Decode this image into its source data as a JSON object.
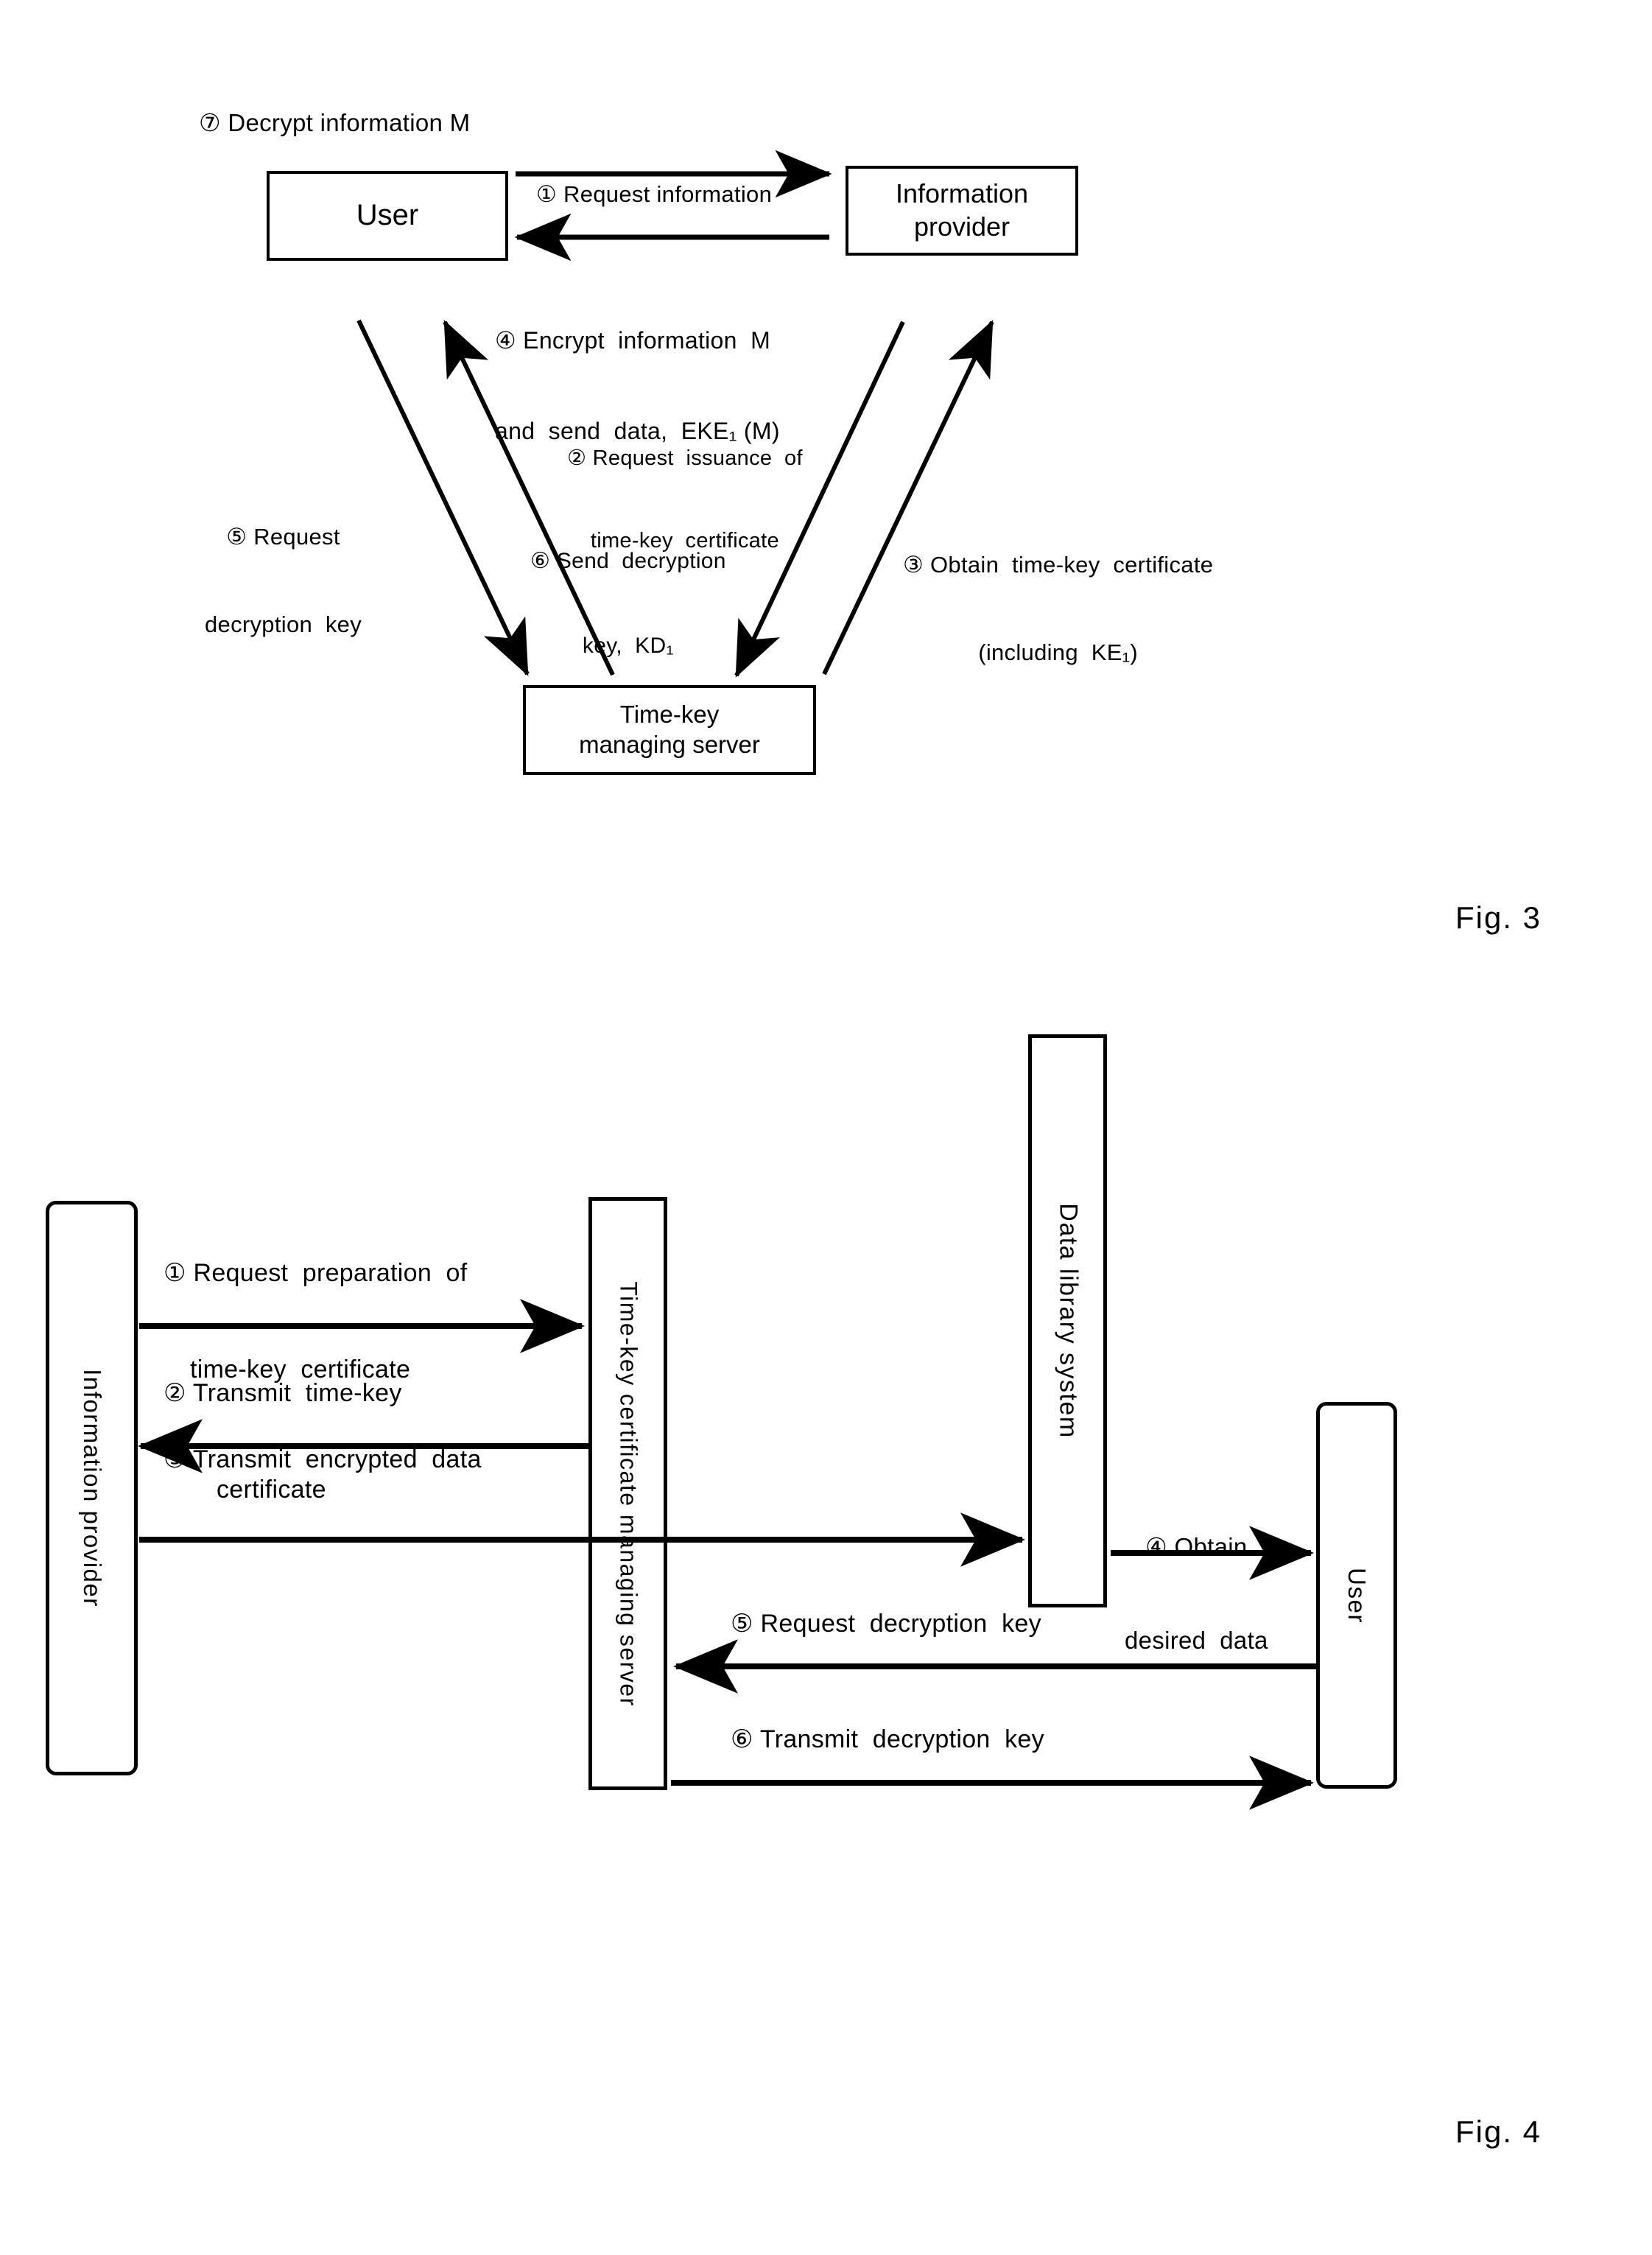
{
  "document": {
    "kind": "patent-figure-sheet",
    "figures": [
      {
        "caption": "Fig. 3"
      },
      {
        "caption": "Fig. 4"
      }
    ]
  },
  "fig3": {
    "caption": "Fig. 3",
    "nodes": {
      "user": "User",
      "provider_line1": "Information",
      "provider_line2": "provider",
      "server_line1": "Time-key",
      "server_line2": "managing server"
    },
    "labels": {
      "step7": "⑦ Decrypt information M",
      "step1": "① Request information",
      "step4_line1": "④ Encrypt  information  M",
      "step4_line2": "and  send  data,  EKE₁ (M)",
      "step2_line1": "② Request  issuance  of",
      "step2_line2": "time-key  certificate",
      "step5_line1": "⑤ Request",
      "step5_line2": "decryption  key",
      "step6_line1": "⑥ Send  decryption",
      "step6_line2": "key,  KD₁",
      "step3_line1": "③ Obtain  time-key  certificate",
      "step3_line2": "(including  KE₁)"
    }
  },
  "fig4": {
    "caption": "Fig. 4",
    "lifelines": {
      "information_provider": "Information provider",
      "timekey_server": "Time-key certificate managing server",
      "data_library": "Data library system",
      "user": "User"
    },
    "messages": {
      "step1_line1": "① Request  preparation  of",
      "step1_line2": "time-key  certificate",
      "step2_line1": "② Transmit  time-key",
      "step2_line2": "certificate",
      "step3": "③ Transmit  encrypted  data",
      "step4_line1": "④ Obtain",
      "step4_line2": "desired  data",
      "step5": "⑤ Request  decryption  key",
      "step6": "⑥ Transmit  decryption  key"
    }
  },
  "colors": {
    "ink": "#000000",
    "paper": "#ffffff"
  }
}
